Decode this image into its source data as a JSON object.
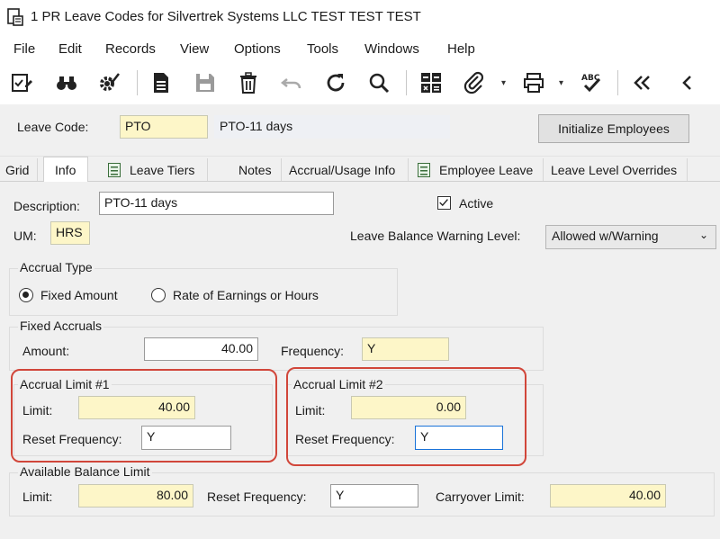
{
  "window": {
    "title": "1 PR Leave Codes for Silvertrek Systems LLC TEST TEST TEST"
  },
  "menu": [
    "File",
    "Edit",
    "Records",
    "View",
    "Options",
    "Tools",
    "Windows",
    "Help"
  ],
  "toolbar": {
    "icons": [
      "checklist-icon",
      "binoculars-icon",
      "gear-check-icon",
      "new-document-icon",
      "save-icon",
      "delete-icon",
      "undo-icon",
      "refresh-icon",
      "search-icon",
      "calculator-icon",
      "attachment-icon",
      "print-icon",
      "spellcheck-icon",
      "first-record-icon",
      "previous-record-icon"
    ]
  },
  "header": {
    "leave_code_label": "Leave Code:",
    "leave_code_value": "PTO",
    "leave_code_desc": "PTO-11 days",
    "init_button": "Initialize Employees"
  },
  "tabs": [
    "Grid",
    "Info",
    "Leave Tiers",
    "Notes",
    "Accrual/Usage Info",
    "Employee Leave",
    "Leave Level Overrides"
  ],
  "info": {
    "description_label": "Description:",
    "description_value": "PTO-11 days",
    "active_label": "Active",
    "um_label": "UM:",
    "um_value": "HRS",
    "warning_label": "Leave Balance Warning Level:",
    "warning_value": "Allowed w/Warning"
  },
  "accrual_type": {
    "title": "Accrual Type",
    "option1": "Fixed Amount",
    "option2": "Rate of Earnings or Hours"
  },
  "fixed_accruals": {
    "title": "Fixed Accruals",
    "amount_label": "Amount:",
    "amount_value": "40.00",
    "frequency_label": "Frequency:",
    "frequency_value": "Y"
  },
  "limit1": {
    "title": "Accrual Limit #1",
    "limit_label": "Limit:",
    "limit_value": "40.00",
    "reset_label": "Reset Frequency:",
    "reset_value": "Y"
  },
  "limit2": {
    "title": "Accrual Limit #2",
    "limit_label": "Limit:",
    "limit_value": "0.00",
    "reset_label": "Reset Frequency:",
    "reset_value": "Y"
  },
  "available": {
    "title": "Available Balance Limit",
    "limit_label": "Limit:",
    "limit_value": "80.00",
    "reset_label": "Reset Frequency:",
    "reset_value": "Y",
    "carryover_label": "Carryover Limit:",
    "carryover_value": "40.00"
  },
  "colors": {
    "highlight": "#d1463a",
    "required_field": "#fdf6c8"
  }
}
